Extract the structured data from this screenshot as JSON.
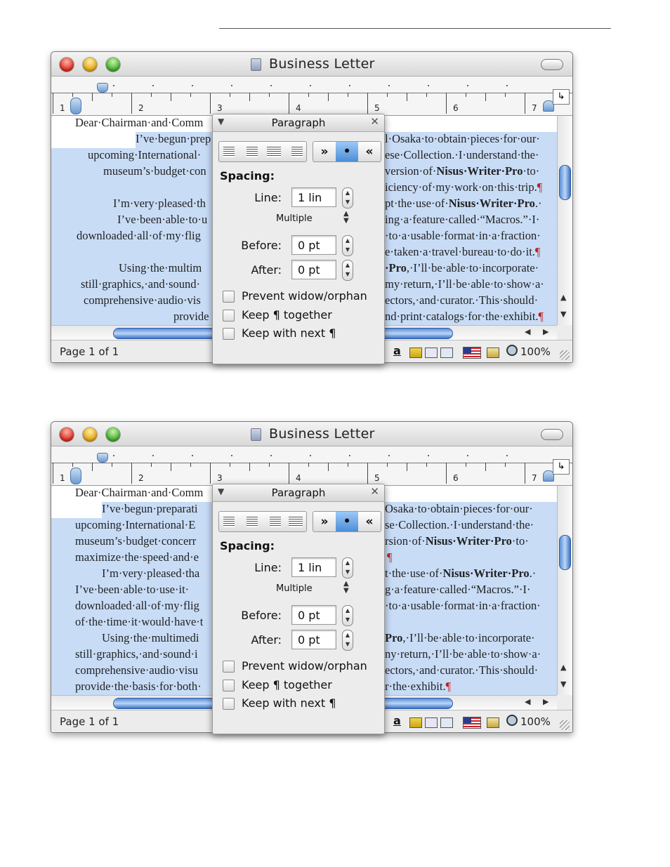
{
  "window": {
    "title": "Business Letter",
    "ruler_numbers": [
      "1",
      "2",
      "3",
      "4",
      "5",
      "6",
      "7"
    ],
    "tab_well_glyph": "↳",
    "status": {
      "page_label": "Page 1 of 1",
      "text_glyph": "a",
      "zoom": "100%"
    }
  },
  "panel": {
    "title": "Paragraph",
    "collapse_glyph": "▼",
    "close_glyph": "✕",
    "alignment": [
      "left",
      "center",
      "justify",
      "right"
    ],
    "direction": {
      "ltr": "»",
      "none": "•",
      "rtl": "«"
    },
    "spacing_heading": "Spacing:",
    "line_label": "Line:",
    "line_value": "1 lin",
    "line_mode": "Multiple",
    "before_label": "Before:",
    "before_value": "0 pt",
    "after_label": "After:",
    "after_value": "0 pt",
    "checkboxes": {
      "widow": "Prevent widow/orphan",
      "keep_together": "Keep ¶ together",
      "keep_next": "Keep with next ¶"
    }
  },
  "doc1": {
    "l0": "Dear·Chairman·and·Comm",
    "l1a": "I’ve·begun·prep",
    "l1b": "l·Osaka·to·obtain·pieces·for·our·",
    "l2a": "upcoming·International·",
    "l2b": "ese·Collection.·I·understand·the·",
    "l3a": "museum’s·budget·con",
    "l3b_pre": "version·of·",
    "l3b_bold": "Nisus·Writer·Pro",
    "l3b_post": "·to·",
    "l4b": "iciency·of·my·work·on·this·trip.",
    "l5a": "I’m·very·pleased·th",
    "l5b_pre": "pt·the·use·of·",
    "l5b_bold": "Nisus·Writer·Pro",
    "l5b_post": ".·",
    "l6a": "I’ve·been·able·to·u",
    "l6b": "ing·a·feature·called·“Macros.”·I·",
    "l7a": "downloaded·all·of·my·flig",
    "l7b": "·to·a·usable·format·in·a·fraction·",
    "l8b": "e·taken·a·travel·bureau·to·do·it.",
    "l9a": "Using·the·multim",
    "l9b_bold": "·Pro",
    "l9b_post": ",·I’ll·be·able·to·incorporate·",
    "l10a": "still·graphics,·and·sound·",
    "l10b": "my·return,·I’ll·be·able·to·show·a·",
    "l11a": "comprehensive·audio·vis",
    "l11b": "ectors,·and·curator.·This·should·",
    "l12a": "provide",
    "l12b": "nd·print·catalogs·for·the·exhibit.",
    "pilcrow": "¶"
  },
  "doc2": {
    "l0": "Dear·Chairman·and·Comm",
    "l1a": "I’ve·begun·preparati",
    "l1b": "Osaka·to·obtain·pieces·for·our·",
    "l2a": "upcoming·International·E",
    "l2b": "se·Collection.·I·understand·the·",
    "l3a": "museum’s·budget·concerr",
    "l3b_pre": "rsion·of·",
    "l3b_bold": "Nisus·Writer·Pro",
    "l3b_post": "·to·",
    "l4a": "maximize·the·speed·and·e",
    "l5a": "I’m·very·pleased·tha",
    "l5b_pre": "t·the·use·of·",
    "l5b_bold": "Nisus·Writer·Pro",
    "l5b_post": ".·",
    "l6a": "I’ve·been·able·to·use·it·",
    "l6b": "g·a·feature·called·“Macros.”·I·",
    "l7a": "downloaded·all·of·my·flig",
    "l7b": "·to·a·usable·format·in·a·fraction·",
    "l8a": "of·the·time·it·would·have·t",
    "l9a": "Using·the·multimedi",
    "l9b_bold": "Pro",
    "l9b_post": ",·I’ll·be·able·to·incorporate·",
    "l10a": "still·graphics,·and·sound·i",
    "l10b": "ny·return,·I’ll·be·able·to·show·a·",
    "l11a": "comprehensive·audio·visu",
    "l11b": "ectors,·and·curator.·This·should·",
    "l12a": "provide·the·basis·for·both·",
    "l12b": "r·the·exhibit.",
    "pilcrow": "¶"
  }
}
